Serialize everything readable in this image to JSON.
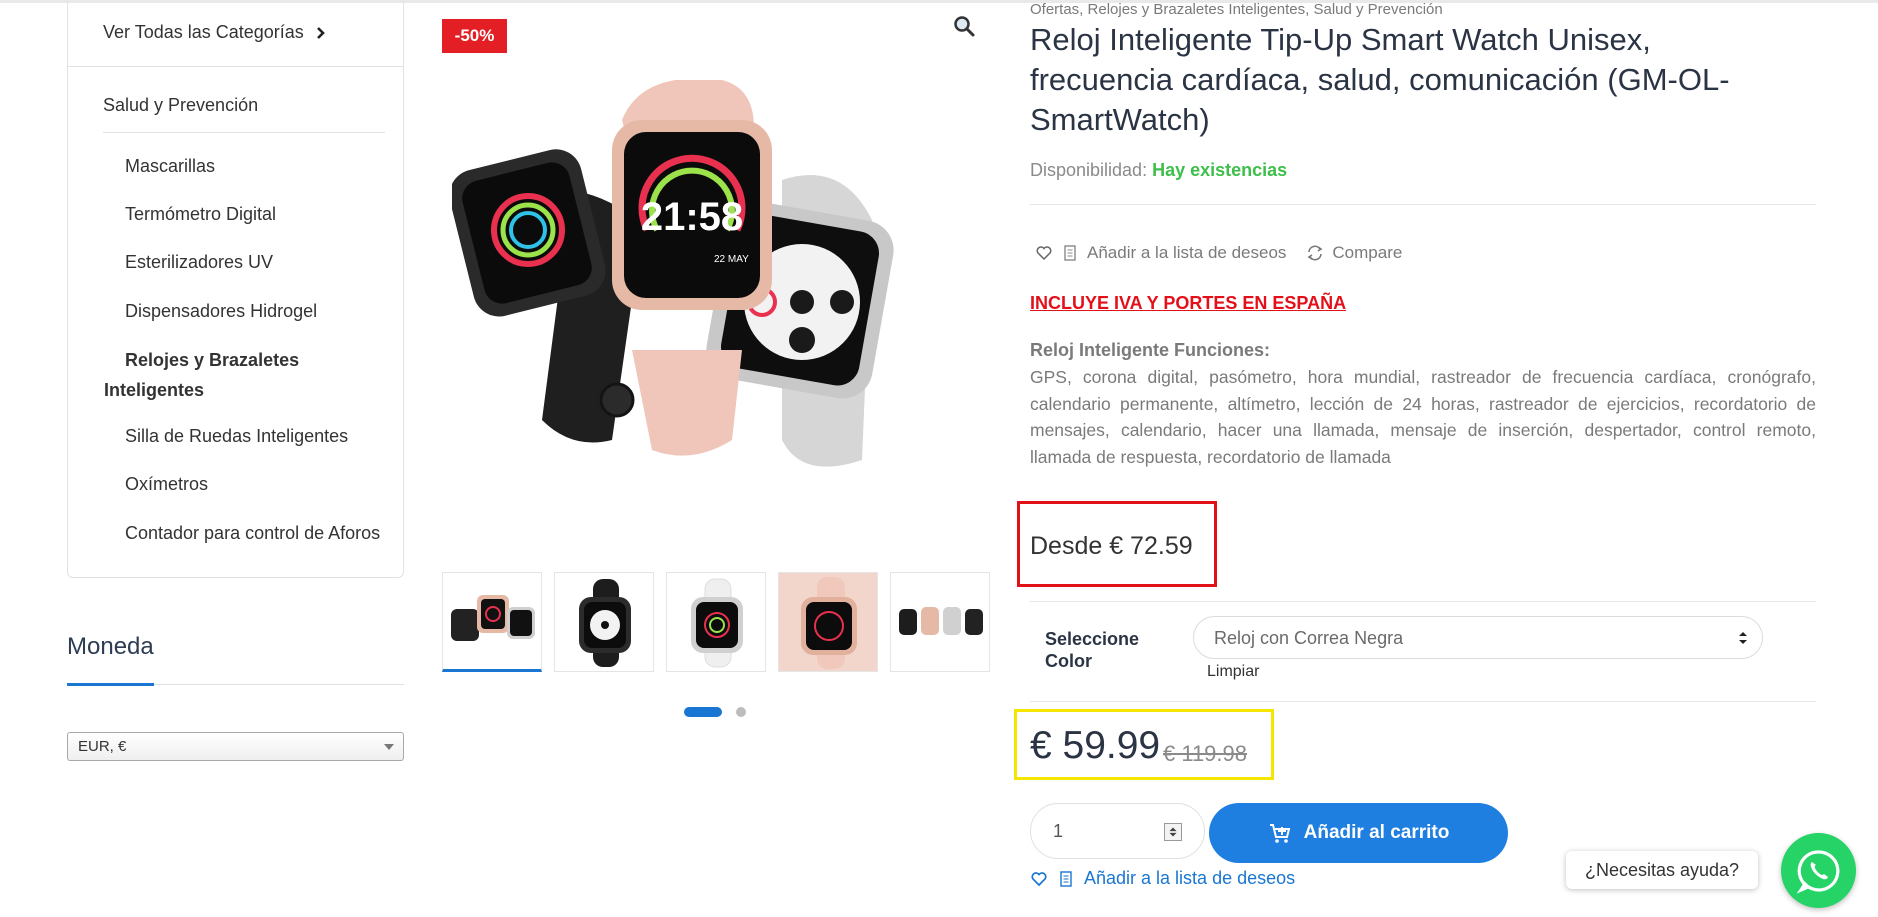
{
  "sidebar": {
    "all_categories": "Ver Todas las Categorías",
    "parent_category": "Salud y Prevención",
    "subcategories": [
      "Mascarillas",
      "Termómetro Digital",
      "Esterilizadores UV",
      "Dispensadores Hidrogel"
    ],
    "active_line1": "Relojes y Brazaletes",
    "active_line2": "Inteligentes",
    "subcategories_after": [
      "Silla de Ruedas Inteligentes",
      "Oxímetros",
      "Contador para control de Aforos"
    ],
    "currency_title": "Moneda",
    "currency_value": "EUR, €"
  },
  "gallery": {
    "sale_badge": "-50%",
    "thumbnail_count": 5,
    "active_dot": 1,
    "dot_count": 2
  },
  "product": {
    "breadcrumb": "Ofertas, Relojes y Brazaletes Inteligentes, Salud y Prevención",
    "title": "Reloj Inteligente Tip-Up Smart Watch Unisex, frecuencia cardíaca, salud, comunicación (GM-OL-SmartWatch)",
    "availability_label": "Disponibilidad:",
    "availability_value": "Hay existencias",
    "wishlist_label": "Añadir a la lista de deseos",
    "compare_label": "Compare",
    "promo": "INCLUYE IVA Y PORTES EN ESPAÑA",
    "features_title": "Reloj Inteligente Funciones:",
    "features_text": "GPS, corona digital, pasómetro, hora mundial, rastreador de frecuencia cardíaca, cronógrafo, calendario permanente, altímetro, lección de 24 horas, rastreador de ejercicios, recordatorio de mensajes, calendario, hacer una llamada, mensaje de inserción, despertador, control remoto, llamada de respuesta, recordatorio de llamada",
    "from_price": "Desde € 72.59",
    "select_label": "Seleccione Color",
    "select_value": "Reloj con Correa Negra",
    "clear_label": "Limpiar",
    "price_now": "€ 59.99",
    "price_old": "€ 119.98",
    "quantity": "1",
    "add_to_cart": "Añadir al carrito",
    "wishlist_label_2": "Añadir a la lista de deseos"
  },
  "help": {
    "bubble": "¿Necesitas ayuda?"
  },
  "colors": {
    "accent_blue": "#1e7fe0",
    "sale_red": "#e31e24",
    "stock_green": "#3ebe4a",
    "highlight_yellow": "#f5e600",
    "whatsapp_green": "#25d366"
  }
}
